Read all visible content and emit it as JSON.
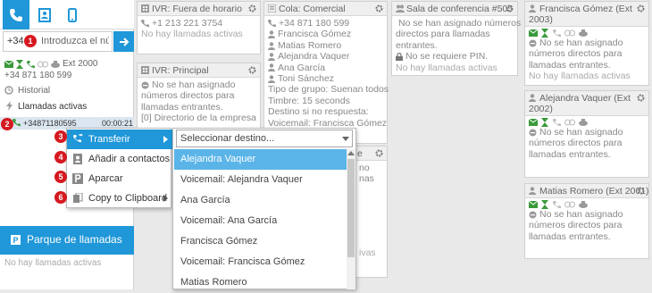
{
  "left": {
    "number_prefix": "+34",
    "number_placeholder": "Introduzca el núm",
    "ext": "Ext 2000",
    "phone": "+34 871 180 599",
    "historial": "Historial",
    "llamadas_activas": "Llamadas activas",
    "active_call_number": "+34871180595",
    "active_call_time": "00:00:21",
    "parque_title": "Parque de llamadas",
    "parque_empty": "No hay llamadas activas"
  },
  "cards": {
    "fuera": {
      "title": "IVR: Fuera de horario",
      "phone": "+1 213 221 3754",
      "empty": "No hay llamadas activas"
    },
    "principal": {
      "title": "IVR: Principal",
      "l1": "No se han asignado",
      "l2": "números directos para",
      "l3": "llamadas entrantes.",
      "l4": "[0] Directorio de la empresa"
    },
    "comercial": {
      "title": "Cola: Comercial",
      "phone": "+34 871 180 599",
      "m1": "Francisca Gómez",
      "m2": "Matias Romero",
      "m3": "Alejandra Vaquer",
      "m4": "Ana García",
      "m5": "Toni Sánchez",
      "t1": "Tipo de grupo: Suenan todos",
      "t2": "Timbre: 15 seconds",
      "t3": "Destino si no respuesta:",
      "t4": "Voicemail: Francisca Gómez"
    },
    "conf": {
      "title": "Sala de conferencia #505",
      "l1": "No se han asignado números",
      "l2": "directos para llamadas",
      "l3": "entrantes.",
      "l4": "No se requiere PIN.",
      "empty": "No hay llamadas activas"
    },
    "francisca": {
      "title": "Francisca Gómez (Ext",
      "title2": "2003)",
      "l1": "No se han asignado",
      "l2": "números directos para",
      "l3": "llamadas entrantes.",
      "empty": "No hay llamadas activas"
    },
    "alejandra": {
      "title": "Alejandra Vaquer (Ext",
      "title2": "2002)",
      "l1": "No se han asignado",
      "l2": "números directos para",
      "l3": "llamadas entrantes."
    },
    "matias": {
      "title": "Matias Romero (Ext 2001)",
      "l1": "No se han asignado",
      "l2": "números directos para",
      "l3": "llamadas entrantes."
    },
    "hidden_right": {
      "l1": "no",
      "l2": "nas",
      "l3": "ivas",
      "title": "e"
    }
  },
  "menu": {
    "badges": [
      "1",
      "2",
      "3",
      "4",
      "5",
      "6"
    ],
    "items": [
      "Transferir",
      "Añadir a contactos",
      "Aparcar",
      "Copy to Clipboard"
    ]
  },
  "dropdown": {
    "placeholder": "Seleccionar destino...",
    "options": [
      "Alejandra Vaquer",
      "Voicemail: Alejandra Vaquer",
      "Ana García",
      "Voicemail: Ana García",
      "Francisca Gómez",
      "Voicemail: Francisca Gómez",
      "Matias Romero"
    ]
  },
  "colors": {
    "accent": "#1f97d8",
    "badge": "#d51920",
    "selected_option": "#5ab4e8"
  }
}
